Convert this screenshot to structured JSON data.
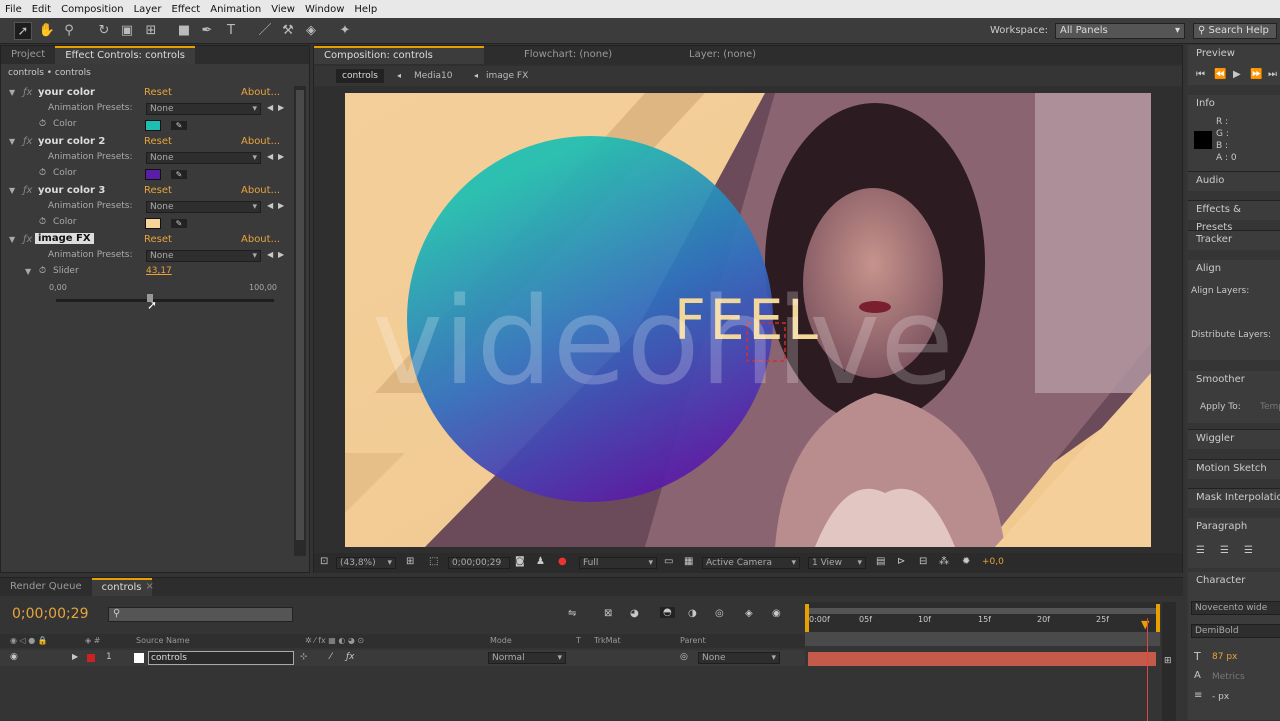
{
  "menubar": {
    "items": [
      "File",
      "Edit",
      "Composition",
      "Layer",
      "Effect",
      "Animation",
      "View",
      "Window",
      "Help"
    ]
  },
  "toolbar": {
    "workspace_label": "Workspace:",
    "workspace_value": "All Panels",
    "search_help": "Search Help"
  },
  "left_panel": {
    "tabs": [
      "Project",
      "Effect Controls: controls"
    ],
    "breadcrumb": "controls • controls",
    "reset": "Reset",
    "about": "About...",
    "effects": [
      {
        "name": "your color",
        "preset_label": "Animation Presets:",
        "preset_value": "None",
        "prop_label": "Color",
        "color": "#1ebfb2"
      },
      {
        "name": "your color 2",
        "preset_label": "Animation Presets:",
        "preset_value": "None",
        "prop_label": "Color",
        "color": "#5a1da8"
      },
      {
        "name": "your color 3",
        "preset_label": "Animation Presets:",
        "preset_value": "None",
        "prop_label": "Color",
        "color": "#f6d49a"
      }
    ],
    "image_fx": {
      "name": "image FX",
      "preset_label": "Animation Presets:",
      "preset_value": "None",
      "slider_label": "Slider",
      "slider_value": "43,17",
      "min": "0,00",
      "max": "100,00",
      "slider_fraction": 0.4317
    }
  },
  "comp_panel": {
    "tabs": [
      "Composition: controls",
      "Flowchart: (none)",
      "Layer: (none)"
    ],
    "breadcrumbs": [
      "controls",
      "Media10",
      "image FX"
    ],
    "feel_text": "FEEL",
    "watermark": "videohive",
    "footer": {
      "zoom": "(43,8%)",
      "timecode": "0;00;00;29",
      "resolution": "Full",
      "camera": "Active Camera",
      "views": "1 View",
      "exposure": "+0,0"
    }
  },
  "right_panel": {
    "preview": "Preview",
    "info": "Info",
    "info_values": [
      "R :",
      "G :",
      "B :",
      "A : 0"
    ],
    "audio": "Audio",
    "effects_presets": "Effects & Presets",
    "tracker": "Tracker",
    "align": "Align",
    "align_layers": "Align Layers:",
    "distribute_layers": "Distribute Layers:",
    "smoother": "Smoother",
    "apply_to": "Apply To:",
    "apply_value": "Temp",
    "wiggler": "Wiggler",
    "motion_sketch": "Motion Sketch",
    "mask_interp": "Mask Interpolation",
    "paragraph": "Paragraph",
    "character": "Character",
    "font": "Novecento wide",
    "font_style": "DemiBold",
    "font_size": "87 px",
    "leading": "Metrics",
    "px": "- px"
  },
  "timeline": {
    "tabs": [
      "Render Queue",
      "controls"
    ],
    "timecode": "0;00;00;29",
    "col_source": "Source Name",
    "col_mode": "Mode",
    "col_t": "T",
    "col_trkmat": "TrkMat",
    "col_parent": "Parent",
    "layer": {
      "num": "1",
      "name": "controls",
      "mode": "Normal",
      "parent": "None"
    },
    "ruler": [
      "0:00f",
      "05f",
      "10f",
      "15f",
      "20f",
      "25f"
    ]
  },
  "colors": {
    "accent": "#e8a000",
    "layer_bar": "#c45a4a",
    "teal": "#1ebfb2",
    "purple": "#5a1da8",
    "cream": "#f6d49a"
  }
}
